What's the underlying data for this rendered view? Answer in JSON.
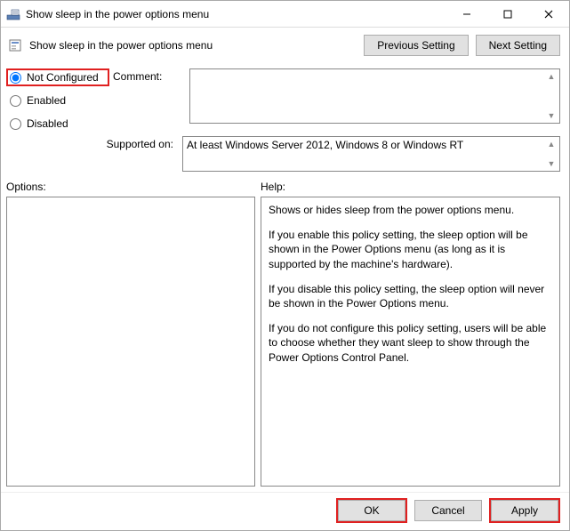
{
  "window": {
    "title": "Show sleep in the power options menu"
  },
  "header": {
    "title": "Show sleep in the power options menu",
    "prev_label": "Previous Setting",
    "next_label": "Next Setting"
  },
  "radios": {
    "not_configured": "Not Configured",
    "enabled": "Enabled",
    "disabled": "Disabled",
    "selected": "not_configured"
  },
  "comment": {
    "label": "Comment:",
    "value": ""
  },
  "supported": {
    "label": "Supported on:",
    "value": "At least Windows Server 2012, Windows 8 or Windows RT"
  },
  "panels": {
    "options_label": "Options:",
    "help_label": "Help:"
  },
  "help": {
    "p1": "Shows or hides sleep from the power options menu.",
    "p2": "If you enable this policy setting, the sleep option will be shown in the Power Options menu (as long as it is supported by the machine's hardware).",
    "p3": "If you disable this policy setting, the sleep option will never be shown in the Power Options menu.",
    "p4": "If you do not configure this policy setting, users will be able to choose whether they want sleep to show through the Power Options Control Panel."
  },
  "footer": {
    "ok": "OK",
    "cancel": "Cancel",
    "apply": "Apply"
  }
}
